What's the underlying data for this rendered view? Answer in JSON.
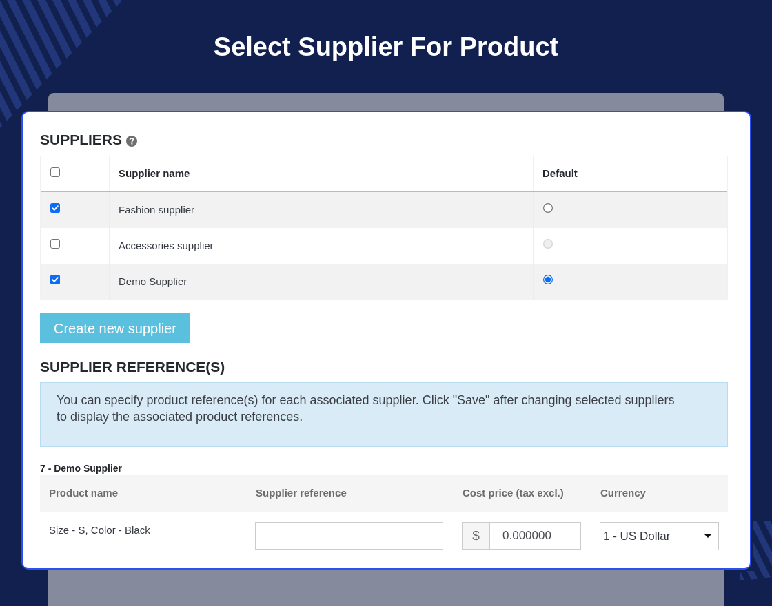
{
  "page": {
    "title": "Select Supplier For Product"
  },
  "suppliers": {
    "heading": "SUPPLIERS",
    "select_all": {
      "checked": false
    },
    "columns": [
      "Supplier name",
      "Default"
    ],
    "rows": [
      {
        "checked": true,
        "name": "Fashion supplier",
        "default_radio": {
          "selected": false,
          "disabled": false
        }
      },
      {
        "checked": false,
        "name": "Accessories supplier",
        "default_radio": {
          "selected": false,
          "disabled": true
        }
      },
      {
        "checked": true,
        "name": "Demo Supplier",
        "default_radio": {
          "selected": true,
          "disabled": false
        }
      }
    ],
    "create_button": "Create new supplier"
  },
  "supplier_references": {
    "heading": "SUPPLIER REFERENCE(S)",
    "info": "You can specify product reference(s) for each associated supplier. Click \"Save\" after changing selected suppliers to display the associated product references.",
    "groups": [
      {
        "title": "7 - Demo Supplier",
        "columns": [
          "Product name",
          "Supplier reference",
          "Cost price (tax excl.)",
          "Currency"
        ],
        "rows": [
          {
            "product_name": "Size - S, Color - Black",
            "cost_price": {
              "prefix": "$",
              "value": "0.000000"
            },
            "currency": "1 - US Dollar"
          }
        ]
      }
    ]
  }
}
